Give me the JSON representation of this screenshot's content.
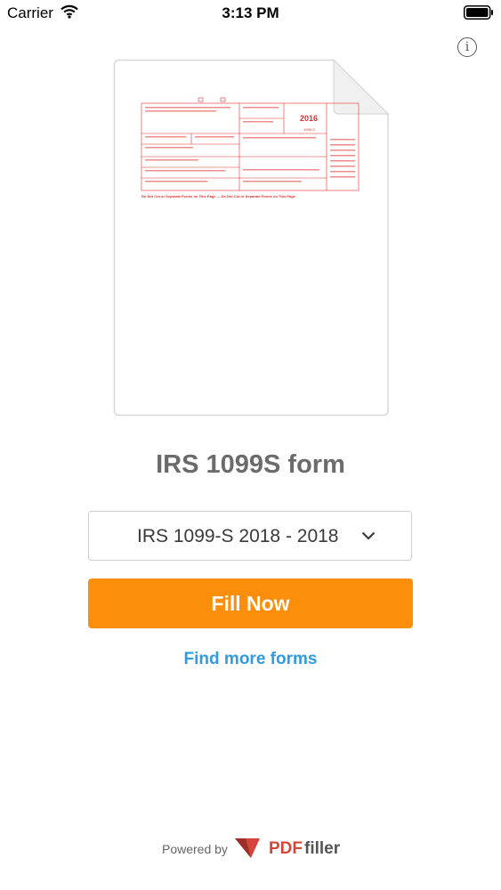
{
  "status_bar": {
    "carrier": "Carrier",
    "time": "3:13 PM"
  },
  "header": {
    "info_icon": "info-icon"
  },
  "preview": {
    "year": "2016",
    "form_code": "1099-S",
    "footer_text": "Do Not Cut or Separate Forms on This Page — Do Not Cut or Separate Forms on This Page"
  },
  "form": {
    "title": "IRS 1099S form"
  },
  "version_select": {
    "selected": "IRS 1099-S 2018 - 2018"
  },
  "actions": {
    "fill_now": "Fill Now",
    "find_more": "Find more forms"
  },
  "footer": {
    "powered_by": "Powered by",
    "brand_prefix": "PDF",
    "brand_suffix": "filler"
  },
  "colors": {
    "accent": "#fb8e0b",
    "link": "#2f9be0",
    "brand": "#d6453a",
    "form_red": "#e03030"
  }
}
